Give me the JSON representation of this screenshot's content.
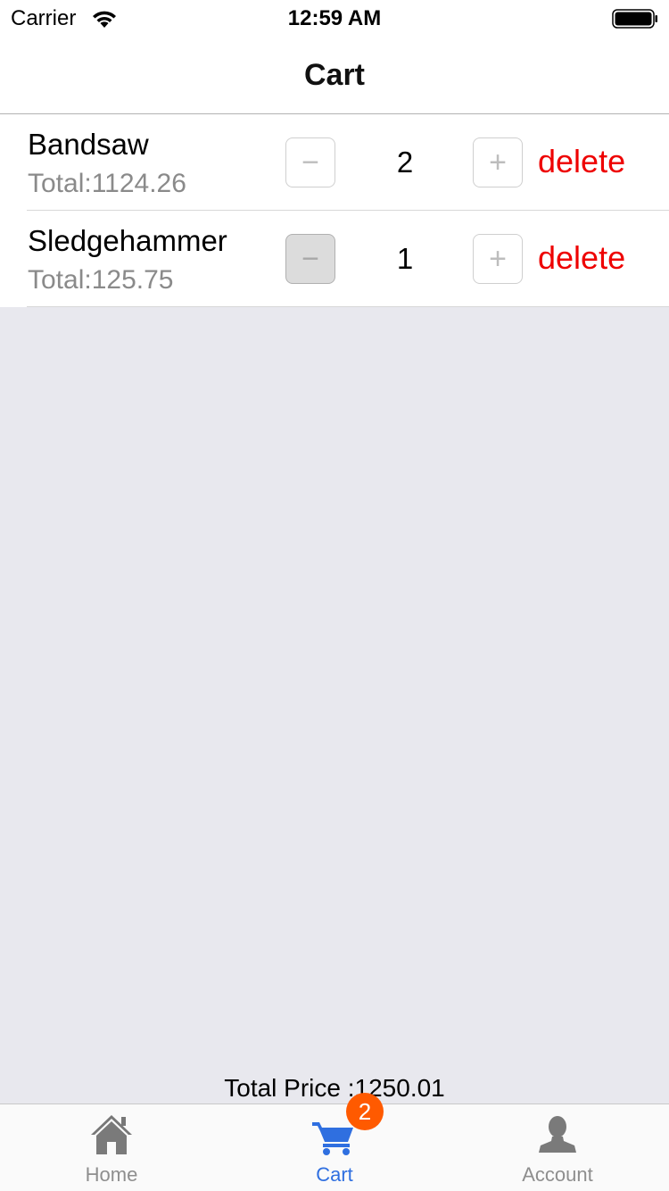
{
  "status_bar": {
    "carrier": "Carrier",
    "time": "12:59 AM",
    "wifi_icon": "wifi-icon",
    "battery_icon": "battery-icon"
  },
  "nav": {
    "title": "Cart"
  },
  "cart": {
    "items": [
      {
        "name": "Bandsaw",
        "total": "Total:1124.26",
        "quantity": "2",
        "minus_label": "−",
        "plus_label": "+",
        "delete_label": "delete",
        "minus_disabled": false
      },
      {
        "name": "Sledgehammer",
        "total": "Total:125.75",
        "quantity": "1",
        "minus_label": "−",
        "plus_label": "+",
        "delete_label": "delete",
        "minus_disabled": true
      }
    ]
  },
  "summary": {
    "total_price": "Total Price :1250.01"
  },
  "tab_bar": {
    "tabs": [
      {
        "label": "Home",
        "icon": "home-icon",
        "active": false
      },
      {
        "label": "Cart",
        "icon": "cart-icon",
        "active": true,
        "badge": "2"
      },
      {
        "label": "Account",
        "icon": "account-icon",
        "active": false
      }
    ]
  },
  "colors": {
    "accent": "#2f6fe0",
    "delete": "#ee0000",
    "badge": "#ff5a00",
    "background": "#e8e8ee"
  }
}
